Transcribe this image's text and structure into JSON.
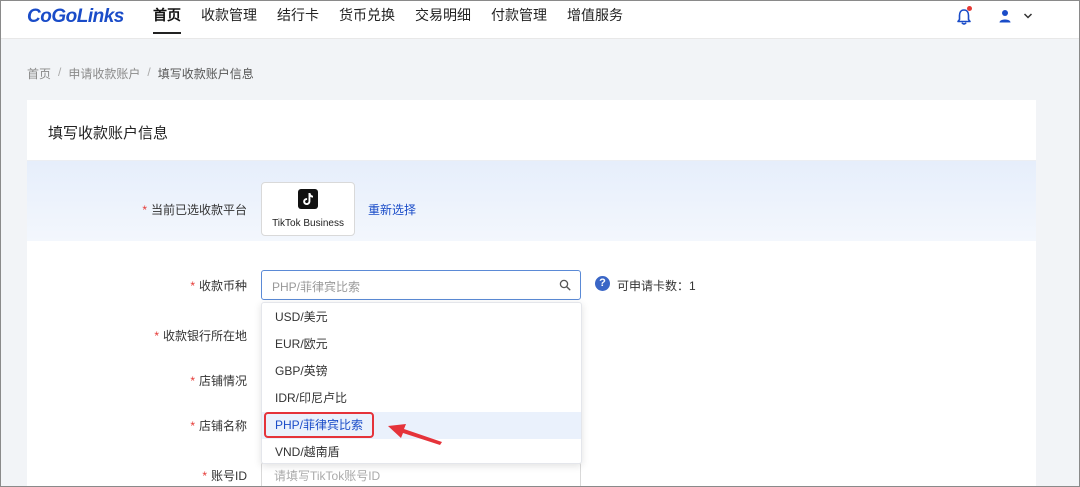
{
  "header": {
    "logo": "CoGoLinks",
    "nav": [
      {
        "label": "首页",
        "active": true
      },
      {
        "label": "收款管理",
        "active": false
      },
      {
        "label": "结行卡",
        "active": false
      },
      {
        "label": "货币兑换",
        "active": false
      },
      {
        "label": "交易明细",
        "active": false
      },
      {
        "label": "付款管理",
        "active": false
      },
      {
        "label": "增值服务",
        "active": false
      }
    ],
    "icons": {
      "bell": "bell-icon",
      "user": "user-icon",
      "user_menu": "chevron-down-icon"
    },
    "notification_dot_color": "#e53935"
  },
  "breadcrumb": {
    "items": [
      "首页",
      "申请收款账户",
      "填写收款账户信息"
    ],
    "separator": "/"
  },
  "card": {
    "title": "填写收款账户信息",
    "platform": {
      "label": "当前已选收款平台",
      "name": "TikTok Business",
      "reselect": "重新选择"
    },
    "currency": {
      "label": "收款币种",
      "value": "PHP/菲律宾比索",
      "quota": "可申请卡数：1"
    },
    "labels": {
      "bank_location": "收款银行所在地",
      "store_status": "店铺情况",
      "store_name": "店铺名称",
      "account_id": "账号ID"
    },
    "account_id_placeholder": "请填写TikTok账号ID",
    "dropdown": {
      "options": [
        "USD/美元",
        "EUR/欧元",
        "GBP/英镑",
        "IDR/印尼卢比",
        "PHP/菲律宾比索",
        "VND/越南盾"
      ],
      "selected_index": 4
    }
  },
  "colors": {
    "brand": "#1a4cc8",
    "required": "#e53935",
    "annotation": "#e5333a"
  }
}
